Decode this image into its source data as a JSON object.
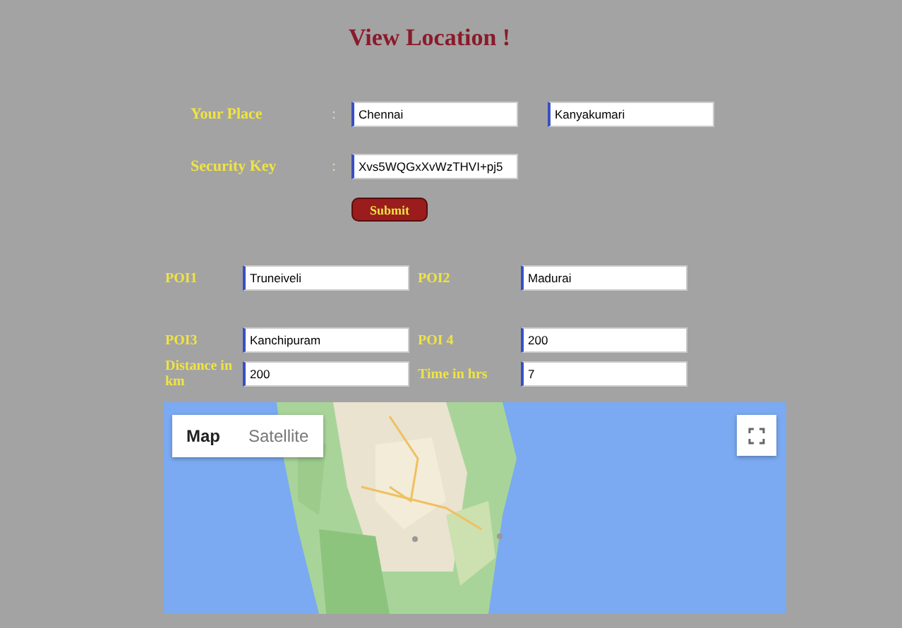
{
  "title": "View Location !",
  "place": {
    "label": "Your Place",
    "separator": ":",
    "from": "Chennai",
    "to": "Kanyakumari"
  },
  "security": {
    "label": "Security Key",
    "separator": ":",
    "value": "Xvs5WQGxXvWzTHVI+pj5"
  },
  "submit": "Submit",
  "fields": [
    {
      "label": "POI1",
      "value": "Truneiveli"
    },
    {
      "label": "POI2",
      "value": "Madurai"
    },
    {
      "label": "POI3",
      "value": "Kanchipuram"
    },
    {
      "label": "POI 4",
      "value": "200"
    },
    {
      "label": "Distance in km",
      "value": "200"
    },
    {
      "label": "Time in hrs",
      "value": "7"
    }
  ],
  "map": {
    "kind": "picture",
    "types": [
      {
        "label": "Map",
        "selected": true
      },
      {
        "label": "Satellite",
        "selected": false
      }
    ]
  }
}
